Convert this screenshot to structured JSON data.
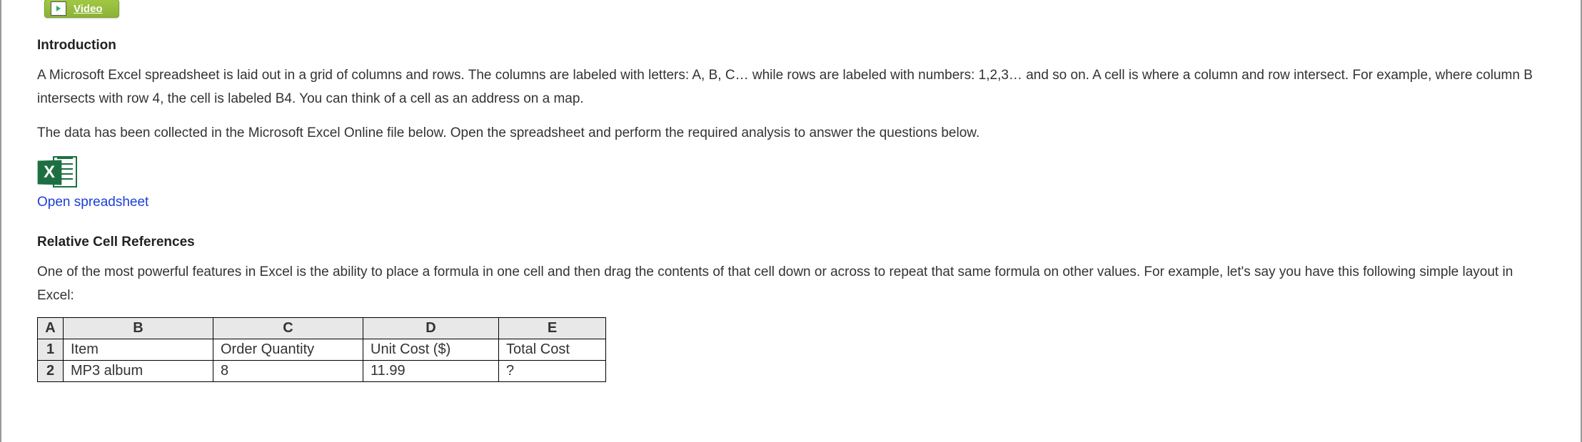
{
  "videoTab": {
    "label": "Video"
  },
  "sections": {
    "intro": {
      "heading": "Introduction",
      "p1": "A Microsoft Excel spreadsheet is laid out in a grid of columns and rows. The columns are labeled with letters: A, B, C… while rows are labeled with numbers: 1,2,3… and so on. A cell is where a column and row intersect. For example, where column B intersects with row 4, the cell is labeled B4. You can think of a cell as an address on a map.",
      "p2": "The data has been collected in the Microsoft Excel Online file below. Open the spreadsheet and perform the required analysis to answer the questions below."
    },
    "link": {
      "label": "Open spreadsheet"
    },
    "relcell": {
      "heading": "Relative Cell References",
      "p1": "One of the most powerful features in Excel is the ability to place a formula in one cell and then drag the contents of that cell down or across to repeat that same formula on other values. For example, let's say you have this following simple layout in Excel:"
    }
  },
  "excelIcon": {
    "letter": "X"
  },
  "table": {
    "cols": {
      "A": "A",
      "B": "B",
      "C": "C",
      "D": "D",
      "E": "E"
    },
    "rows": [
      {
        "n": "1",
        "B": "Item",
        "C": "Order Quantity",
        "D": "Unit Cost ($)",
        "E": "Total Cost"
      },
      {
        "n": "2",
        "B": "MP3 album",
        "C": "8",
        "D": "11.99",
        "E": "?"
      }
    ]
  }
}
